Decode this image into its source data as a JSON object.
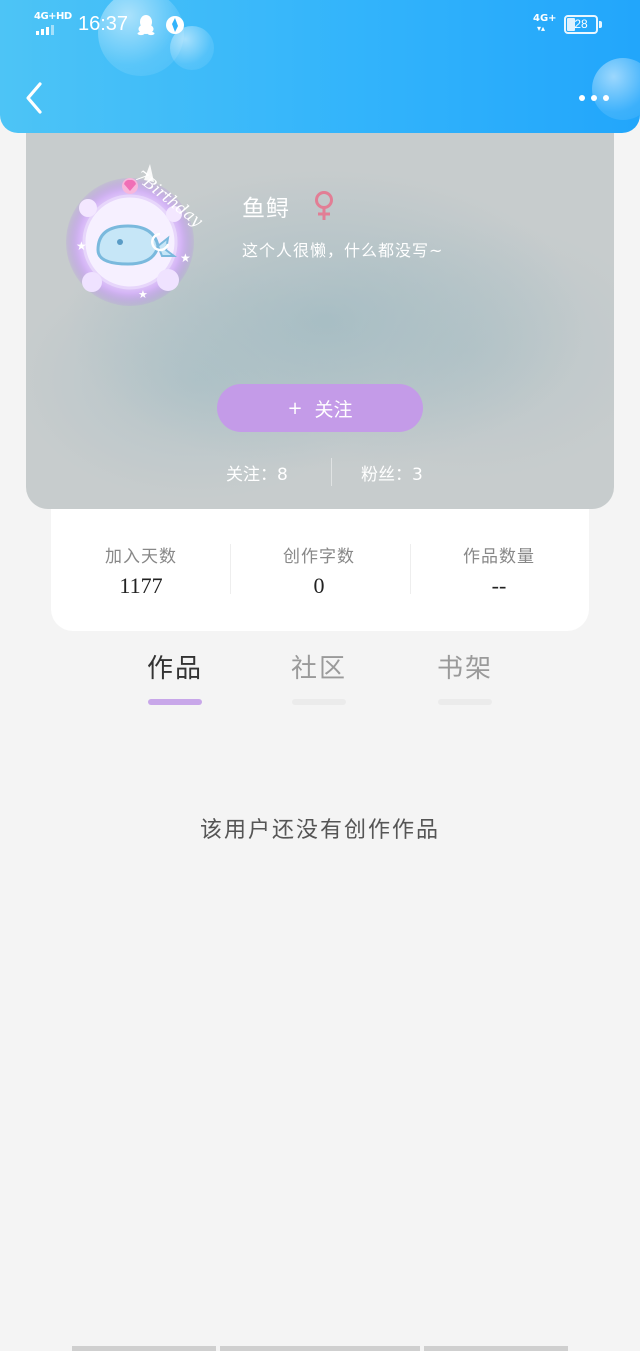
{
  "status_bar": {
    "network_left": "4G+HD",
    "time": "16:37",
    "network_right": "4G+",
    "battery": "28",
    "battery_level_percent": 28,
    "icons": [
      "qq-icon",
      "compass-icon"
    ]
  },
  "header": {
    "back_icon": "chevron-left-icon",
    "more_icon": "more-dots-icon",
    "color": "#33b4fb"
  },
  "profile": {
    "avatar_caption": "7Birthday",
    "username": "鱼鲟",
    "gender_symbol": "♀",
    "gender_color": "#e27e95",
    "bio": "这个人很懒，什么都没写~",
    "follow_plus": "+",
    "follow_label": "关注",
    "follow_button_color": "#c49be8",
    "following_text": "关注：8",
    "fans_text": "粉丝：3"
  },
  "stats": [
    {
      "label": "加入天数",
      "value": "1177"
    },
    {
      "label": "创作字数",
      "value": "0"
    },
    {
      "label": "作品数量",
      "value": "--"
    }
  ],
  "tabs": [
    {
      "label": "作品",
      "active": true
    },
    {
      "label": "社区",
      "active": false
    },
    {
      "label": "书架",
      "active": false
    }
  ],
  "accent_color": "#c8a7e9",
  "empty_message": "该用户还没有创作作品"
}
